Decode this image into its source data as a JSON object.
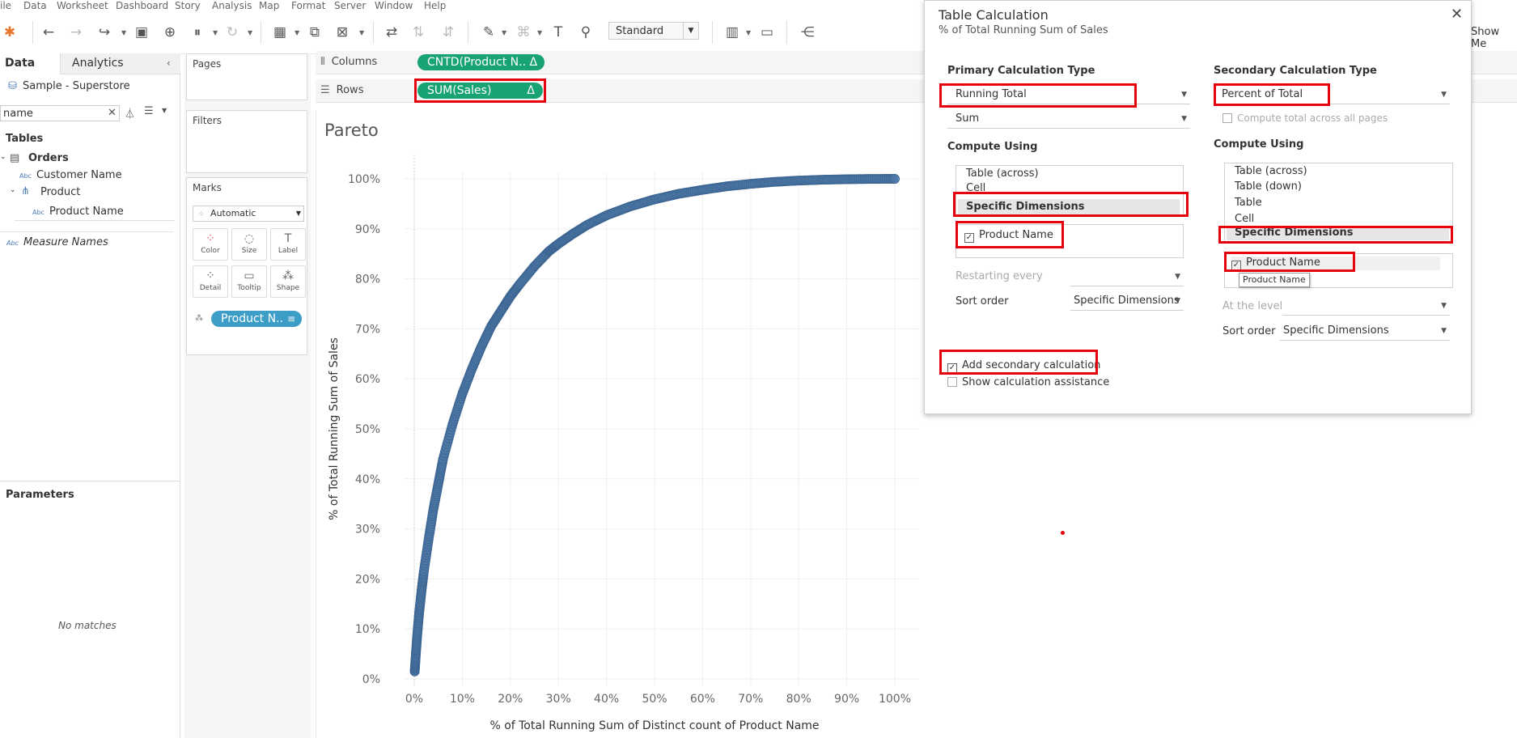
{
  "menu": [
    "ile",
    "Data",
    "Worksheet",
    "Dashboard",
    "Story",
    "Analysis",
    "Map",
    "Format",
    "Server",
    "Window",
    "Help"
  ],
  "toolbar": {
    "fit_mode": "Standard",
    "show_me": "Show Me"
  },
  "data_pane": {
    "tabs": [
      "Data",
      "Analytics"
    ],
    "data_source": "Sample - Superstore",
    "search_value": "name",
    "tables_heading": "Tables",
    "tree": {
      "orders": "Orders",
      "customer_name": "Customer Name",
      "product": "Product",
      "product_name": "Product Name",
      "measure_names": "Measure Names"
    },
    "parameters_heading": "Parameters",
    "no_matches": "No matches"
  },
  "cards": {
    "pages": "Pages",
    "filters": "Filters",
    "marks": "Marks",
    "mark_type": "Automatic",
    "mark_buttons": [
      "Color",
      "Size",
      "Label",
      "Detail",
      "Tooltip",
      "Shape"
    ],
    "detail_pill": "Product N.."
  },
  "shelves": {
    "columns_label": "Columns",
    "rows_label": "Rows",
    "columns_pill": "CNTD(Product N.. Δ",
    "rows_pill": "SUM(Sales)",
    "rows_delta": "Δ"
  },
  "chart_data": {
    "type": "scatter",
    "title": "Pareto",
    "xlabel": "% of Total Running Sum of Distinct count of Product Name",
    "ylabel": "% of Total Running Sum of Sales",
    "xlim": [
      0,
      100
    ],
    "ylim": [
      0,
      100
    ],
    "x_ticks": [
      "0%",
      "10%",
      "20%",
      "30%",
      "40%",
      "50%",
      "60%",
      "70%",
      "80%",
      "90%",
      "100%"
    ],
    "y_ticks": [
      "0%",
      "10%",
      "20%",
      "30%",
      "40%",
      "50%",
      "60%",
      "70%",
      "80%",
      "90%",
      "100%"
    ],
    "series": [
      {
        "color": "#4e79a7",
        "x": [
          0.1,
          0.3,
          0.6,
          1,
          1.5,
          2,
          3,
          4,
          5,
          6,
          8,
          10,
          12,
          14,
          16,
          18,
          20,
          22,
          25,
          28,
          30,
          33,
          36,
          40,
          45,
          50,
          55,
          60,
          65,
          70,
          75,
          80,
          85,
          90,
          95,
          100
        ],
        "y": [
          1.5,
          4.5,
          8.5,
          13,
          17.5,
          21.5,
          28,
          34,
          39,
          44,
          51,
          57,
          62,
          66.5,
          70.5,
          73.5,
          76.5,
          79,
          82.5,
          85.5,
          87,
          89,
          90.8,
          92.7,
          94.5,
          95.9,
          97,
          97.8,
          98.5,
          99,
          99.4,
          99.65,
          99.82,
          99.92,
          99.98,
          100
        ]
      }
    ],
    "grid": true
  },
  "dialog": {
    "title": "Table Calculation",
    "subtitle": "% of Total Running Sum of Sales",
    "primary": {
      "heading": "Primary Calculation Type",
      "type": "Running Total",
      "aggregation": "Sum",
      "compute_heading": "Compute Using",
      "compute_options": [
        "Table (across)",
        "Cell",
        "Specific Dimensions"
      ],
      "dimension": "Product Name",
      "restarting_label": "Restarting every",
      "sort_label": "Sort order",
      "sort_value": "Specific Dimensions"
    },
    "secondary": {
      "heading": "Secondary Calculation Type",
      "type": "Percent of Total",
      "compute_total_label": "Compute total across all pages",
      "compute_heading": "Compute Using",
      "compute_options": [
        "Table (across)",
        "Table (down)",
        "Table",
        "Cell",
        "Specific Dimensions"
      ],
      "dimension": "Product Name",
      "tooltip": "Product Name",
      "level_label": "At the level",
      "sort_label": "Sort order",
      "sort_value": "Specific Dimensions"
    },
    "add_secondary": "Add secondary calculation",
    "show_assistance": "Show calculation assistance"
  }
}
